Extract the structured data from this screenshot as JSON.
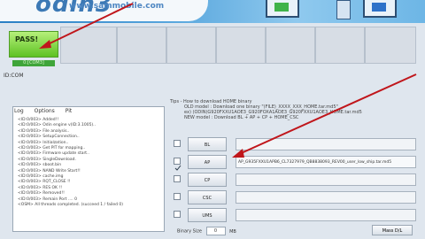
{
  "banner": {
    "logo": "odin3",
    "url": "www.sammobile.com"
  },
  "status": {
    "result": "PASS!",
    "port": "0:[COM3]"
  },
  "id_com_label": "ID:COM",
  "tabs": [
    "Log",
    "Options",
    "Pit"
  ],
  "log_lines": [
    "<ID:0/003> Added!!",
    "<ID:0/003> Odin engine v(ID:3.1005)..",
    "<ID:0/003> File analysis..",
    "<ID:0/003> SetupConnection..",
    "<ID:0/003> Initialzation..",
    "<ID:0/003> Get PIT for mapping..",
    "<ID:0/003> Firmware update start..",
    "<ID:0/003> SingleDownload.",
    "<ID:0/003> sboot.bin",
    "<ID:0/003> NAND Write Start!!",
    "<ID:0/003> cache.img",
    "<ID:0/003> RQT_CLOSE !!",
    "<ID:0/003> RES OK !!",
    "<ID:0/003> Removed!!",
    "<ID:0/003> Remain Port .... 0",
    "<OSM> All threads completed. (succeed 1 / failed 0)"
  ],
  "tips": {
    "heading": "Tips - How to download HOME binary",
    "line1": "OLD model : Download one binary    \"(FILE)_XXXX_XXX_HOME.tar.md5\"",
    "line2": "ex) (ODIN)G920FXXU1AOE3_G920FOXA1AOE3_G920FXXU1AOE3_HOME.tar.md5",
    "line3": "NEW model : Download BL + AP + CP + HOME_CSC"
  },
  "files": [
    {
      "label": "BL",
      "value": "",
      "checked": false
    },
    {
      "label": "AP",
      "value": "AP_G935FXXU1APB6_CL7327979_QB8838093_REV00_user_low_ship.tar.md5",
      "checked": true
    },
    {
      "label": "CP",
      "value": "",
      "checked": false
    },
    {
      "label": "CSC",
      "value": "",
      "checked": false
    },
    {
      "label": "UMS",
      "value": "",
      "checked": false
    }
  ],
  "binary_size_label": "Binary Size",
  "binary_size_value": "0",
  "binary_size_unit": "MB",
  "mass_dl_button": "Mass D/L"
}
